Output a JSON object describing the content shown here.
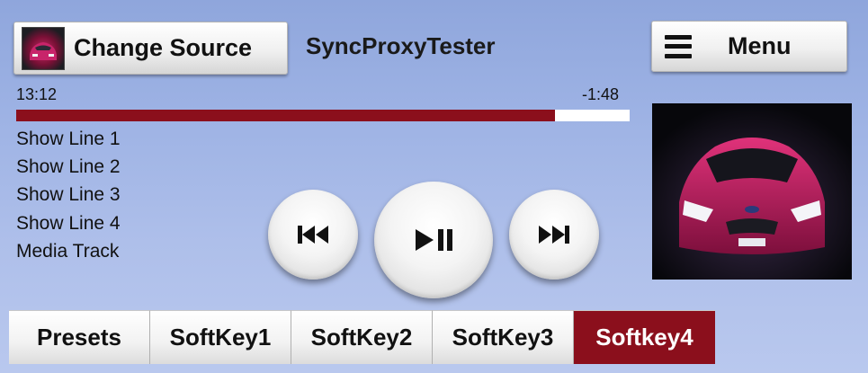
{
  "header": {
    "change_source_label": "Change Source",
    "app_title": "SyncProxyTester",
    "menu_label": "Menu"
  },
  "playback": {
    "elapsed": "13:12",
    "remaining": "-1:48",
    "progress": 0.879,
    "progress_color": "#8b0f1c"
  },
  "show_lines": [
    "Show Line 1",
    "Show Line 2",
    "Show Line 3",
    "Show Line 4",
    "Media Track"
  ],
  "controls": {
    "prev_icon": "skip-previous-icon",
    "playpause_icon": "play-pause-icon",
    "next_icon": "skip-next-icon"
  },
  "softkeys": [
    {
      "label": "Presets",
      "active": false
    },
    {
      "label": "SoftKey1",
      "active": false
    },
    {
      "label": "SoftKey2",
      "active": false
    },
    {
      "label": "SoftKey3",
      "active": false
    },
    {
      "label": "Softkey4",
      "active": true
    }
  ],
  "colors": {
    "accent": "#8b0f1c",
    "background": "#a3b6e6"
  }
}
